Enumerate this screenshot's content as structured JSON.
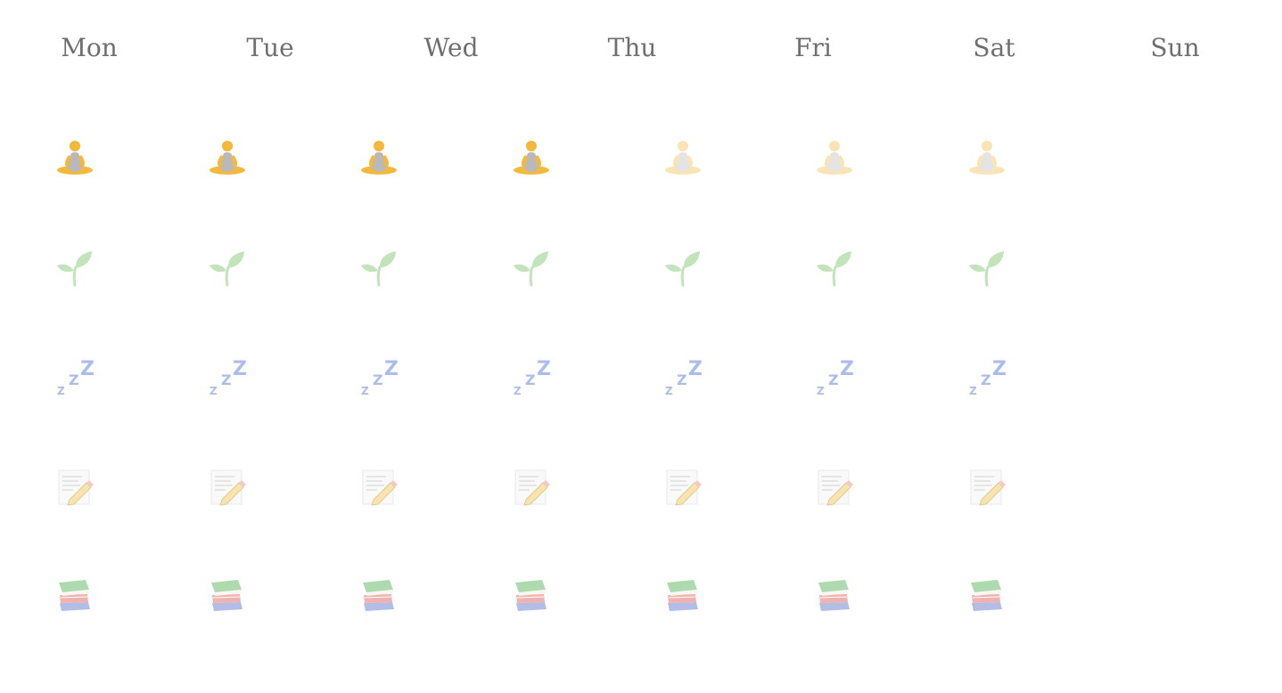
{
  "days": [
    "Mon",
    "Tue",
    "Wed",
    "Thu",
    "Fri",
    "Sat",
    "Sun"
  ],
  "habits": [
    {
      "icon": "meditation-icon",
      "states": [
        "done",
        "done",
        "done",
        "done",
        "faded",
        "faded",
        "faded"
      ]
    },
    {
      "icon": "seedling-icon",
      "states": [
        "light",
        "light",
        "light",
        "light",
        "light",
        "light",
        "light"
      ]
    },
    {
      "icon": "sleep-zzz-icon",
      "states": [
        "light",
        "light",
        "light",
        "light",
        "light",
        "light",
        "light"
      ]
    },
    {
      "icon": "journal-pencil-icon",
      "states": [
        "light",
        "light",
        "light",
        "light",
        "light",
        "light",
        "light"
      ]
    },
    {
      "icon": "books-icon",
      "states": [
        "light",
        "light",
        "light",
        "light",
        "light",
        "light",
        "light"
      ]
    }
  ],
  "colors": {
    "header_text": "#6f6f6f",
    "meditation_skin": "#f4b93a",
    "meditation_clothes": "#b9b9b9",
    "seedling": "#7bc46a",
    "sleep": "#4a6ed6",
    "book_green": "#4caf50",
    "book_red": "#e0574f",
    "book_blue": "#5a6fc9"
  }
}
